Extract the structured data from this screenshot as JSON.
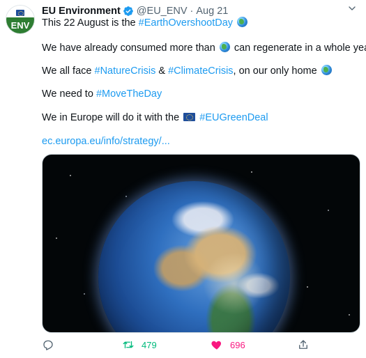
{
  "author": {
    "name": "EU Environment",
    "handle": "@EU_ENV",
    "separator": "·",
    "time": "Aug 21",
    "avatar_text": "ENV",
    "verified": true
  },
  "tweet": {
    "line1_text": "This 22 August is the ",
    "line1_hashtag": "#EarthOvershootDay",
    "line2_a": "We have already consumed more than ",
    "line2_b": " can regenerate in a whole year...",
    "line3_a": "We all face ",
    "line3_hashtag1": "#NatureCrisis",
    "line3_b": " & ",
    "line3_hashtag2": "#ClimateCrisis",
    "line3_c": ", on our only home ",
    "line4_a": "We need to ",
    "line4_hashtag": "#MoveTheDay",
    "line5_a": "We in Europe will do it with the ",
    "line5_hashtag": "#EUGreenDeal",
    "link": "ec.europa.eu/info/strategy/..."
  },
  "actions": {
    "retweets": "479",
    "likes": "696"
  },
  "icons": {
    "verified": "verified-badge-icon",
    "more": "more-options-icon",
    "reply": "reply-icon",
    "retweet": "retweet-icon",
    "like": "heart-icon",
    "share": "share-icon",
    "globe": "globe-emoji-icon",
    "eu_flag": "eu-flag-emoji-icon"
  },
  "colors": {
    "link": "#1d9bf0",
    "retweet": "#00ba7c",
    "like": "#f91880",
    "secondary_text": "#536471",
    "avatar_green": "#2e7d32"
  }
}
